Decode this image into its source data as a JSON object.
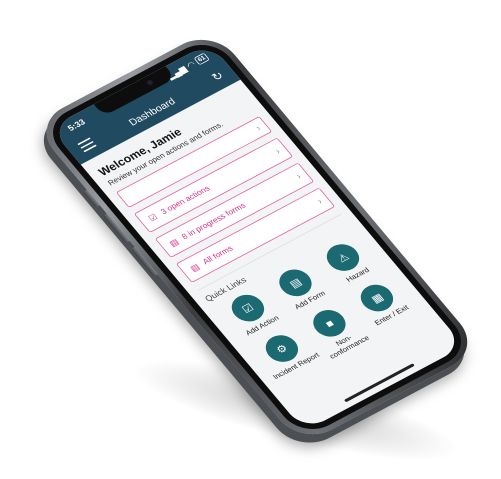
{
  "status_bar": {
    "time": "5:33",
    "battery": "61"
  },
  "header": {
    "title": "Dashboard"
  },
  "welcome": {
    "title": "Welcome, Jamie",
    "subtitle": "Review your open actions and forms."
  },
  "cards": [
    {
      "label": "",
      "icon": "blank"
    },
    {
      "label": "3 open actions",
      "icon": "checkbox-icon"
    },
    {
      "label": "8 in progress forms",
      "icon": "document-icon"
    },
    {
      "label": "All forms",
      "icon": "document-icon"
    }
  ],
  "quick_links": {
    "title": "Quick Links",
    "items": [
      {
        "label": "Add Action",
        "icon": "checkbox-icon"
      },
      {
        "label": "Add Form",
        "icon": "document-icon"
      },
      {
        "label": "Hazard",
        "icon": "warning-icon"
      },
      {
        "label": "Incident Report",
        "icon": "gear-icon"
      },
      {
        "label": "Non-conformance",
        "icon": "stop-icon"
      },
      {
        "label": "Enter / Exit",
        "icon": "qr-code-icon"
      }
    ]
  },
  "colors": {
    "header": "#1f4a5f",
    "accent": "#e25b9b",
    "quick_link": "#1b6a72"
  }
}
